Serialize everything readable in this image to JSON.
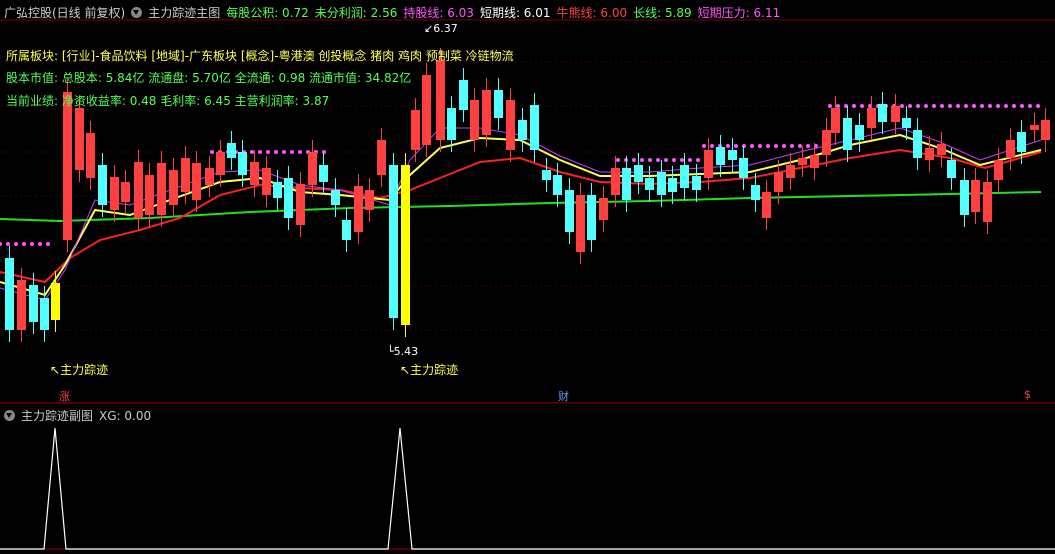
{
  "header": {
    "stock": "广弘控股(日线 前复权)",
    "indicator": "主力踪迹主图",
    "items": [
      {
        "label": "每股公积: 0.72",
        "color": "#54ff54"
      },
      {
        "label": "未分利润: 2.56",
        "color": "#54ff54"
      },
      {
        "label": "持股线: 6.03",
        "color": "#ff54ff"
      },
      {
        "label": "短期线: 6.01",
        "color": "#ffffff"
      },
      {
        "label": "牛熊线: 6.00",
        "color": "#ff4040"
      },
      {
        "label": "长线: 5.89",
        "color": "#54ff54"
      },
      {
        "label": "短期压力: 6.11",
        "color": "#ff54ff"
      }
    ]
  },
  "info": {
    "sector": "所属板块: [行业]-食品饮料 [地域]-广东板块 [概念]-粤港澳 创投概念 猪肉 鸡肉 预制菜 冷链物流",
    "capital": "股本市值: 总股本: 5.84亿 流通盘: 5.70亿 全流通: 0.98 流通市值: 34.82亿",
    "perf": "当前业绩: 净资收益率: 0.48 毛利率: 6.45 主营利润率: 3.87"
  },
  "markers": {
    "high": "6.37",
    "low": "5.43",
    "track1": "主力踪迹",
    "track2": "主力踪迹",
    "tag_zhang": "涨",
    "tag_cai": "财",
    "tag_s": "$"
  },
  "sub": {
    "title": "主力踪迹副图",
    "xg": "XG: 0.00"
  },
  "colors": {
    "up": "#ff4040",
    "down": "#54ffff",
    "short": "#ffff54",
    "bull": "#ff2020",
    "long": "#20e020",
    "hold": "#ff54ff"
  }
}
